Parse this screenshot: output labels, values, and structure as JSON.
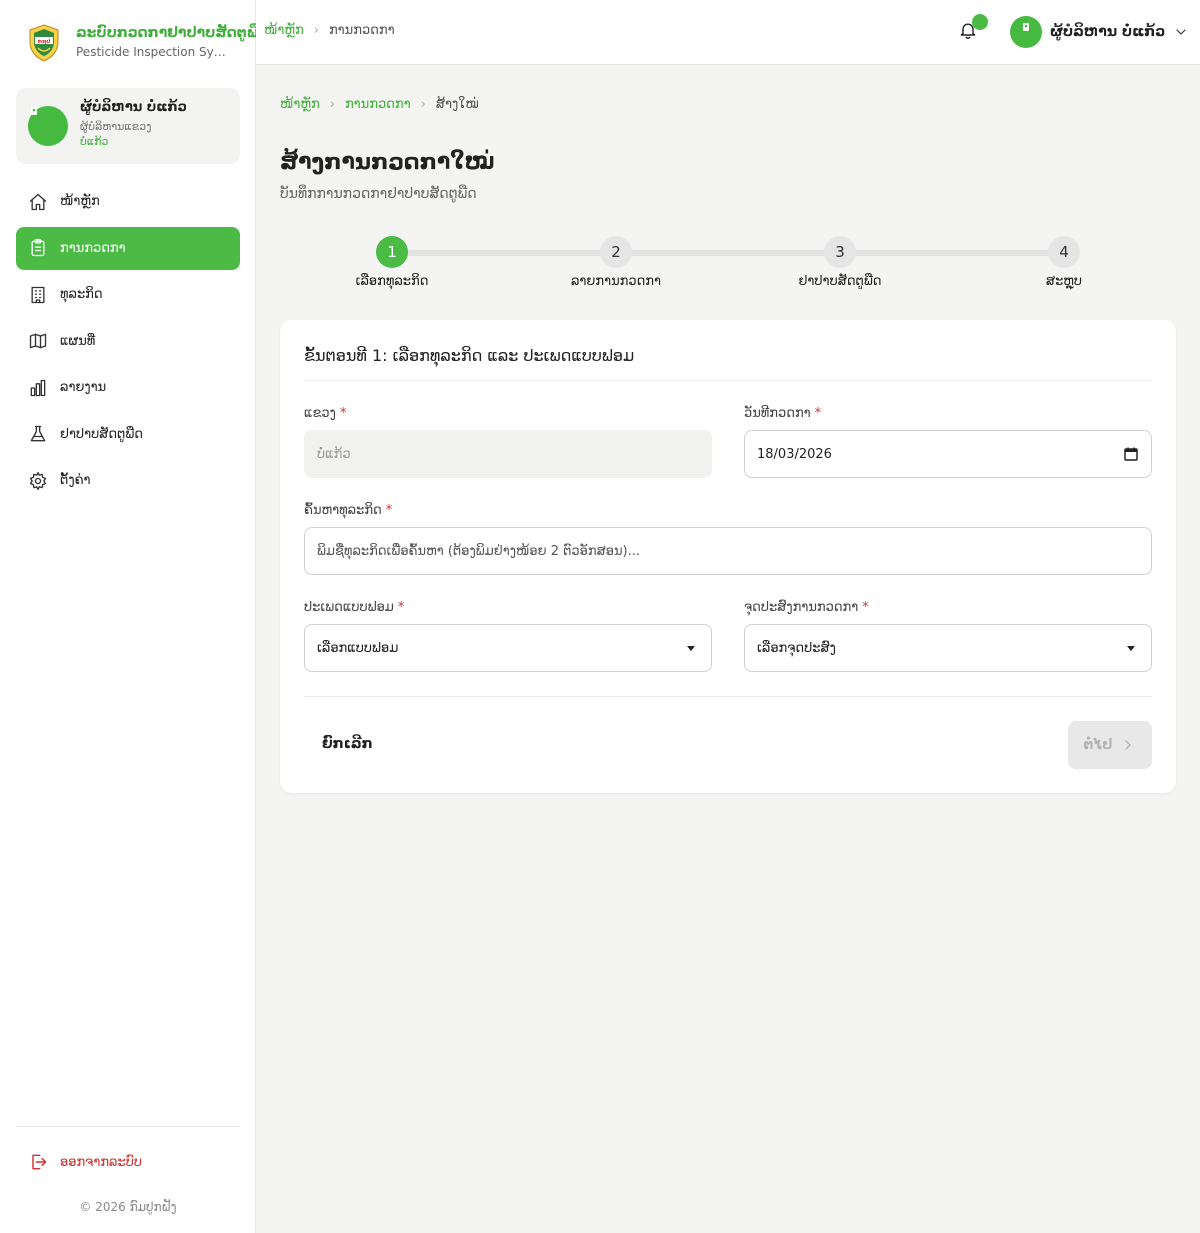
{
  "brand": {
    "title": "ລະບົບກວດກາຢາປາບສັດຕູພືດ",
    "subtitle": "Pesticide Inspection Syst...",
    "logo_text": "ກຊປ",
    "colors": {
      "accent": "#4bbb46",
      "danger": "#d0312d"
    }
  },
  "sidebar_user": {
    "name": "ຜູ້ບໍລິຫານ ບໍ່ແກ້ວ",
    "role": "ຜູ້ບໍລິຫານແຂວງ",
    "province": "ບໍ່ແກ້ວ"
  },
  "nav": {
    "items": [
      {
        "label": "ໜ້າຫຼັກ",
        "icon": "home-icon"
      },
      {
        "label": "ການກວດກາ",
        "icon": "clipboard-icon",
        "active": true
      },
      {
        "label": "ທຸລະກິດ",
        "icon": "building-icon"
      },
      {
        "label": "ແຜນທີ່",
        "icon": "map-icon"
      },
      {
        "label": "ລາຍງານ",
        "icon": "bar-chart-icon"
      },
      {
        "label": "ຢາປາບສັດຕູພືດ",
        "icon": "flask-icon"
      },
      {
        "label": "ຕັ້ງຄ່າ",
        "icon": "gear-icon"
      }
    ],
    "logout": "ອອກຈາກລະບົບ",
    "copyright": "© 2026 ກົມປູກຝັງ"
  },
  "topbar": {
    "breadcrumb_home": "ໜ້າຫຼັກ",
    "breadcrumb_current": "ການກວດກາ",
    "user_name": "ຜູ້ບໍລິຫານ ບໍ່ແກ້ວ"
  },
  "page": {
    "breadcrumb": [
      "ໜ້າຫຼັກ",
      "ການກວດກາ",
      "ສ້າງໃໝ່"
    ],
    "title": "ສ້າງການກວດກາໃໝ່",
    "subtitle": "ບັນທຶກການກວດກາຢາປາບສັດຕູພືດ"
  },
  "stepper": {
    "current": 1,
    "steps": [
      {
        "number": "1",
        "label": "ເລືອກທຸລະກິດ"
      },
      {
        "number": "2",
        "label": "ລາຍການກວດກາ"
      },
      {
        "number": "3",
        "label": "ຢາປາບສັດຕູພືດ"
      },
      {
        "number": "4",
        "label": "ສະຫຼຸບ"
      }
    ]
  },
  "form": {
    "title": "ຂັ້ນຕອນທີ 1: ເລືອກທຸລະກິດ ແລະ ປະເພດແບບຟອມ",
    "required_mark": "*",
    "province": {
      "label": "ແຂວງ",
      "value": "ບໍ່ແກ້ວ"
    },
    "date": {
      "label": "ວັນທີກວດກາ",
      "value": "18/03/2026"
    },
    "business_search": {
      "label": "ຄົ້ນຫາທຸລະກິດ",
      "placeholder": "ພິມຊື່ທຸລະກິດເພື່ອຄົ້ນຫາ (ຕ້ອງພິມຢ່າງໜ້ອຍ 2 ຕົວອັກສອນ)..."
    },
    "form_type": {
      "label": "ປະເພດແບບຟອມ",
      "selected": "ເລືອກແບບຟອມ"
    },
    "purpose": {
      "label": "ຈຸດປະສົງການກວດກາ",
      "selected": "ເລືອກຈຸດປະສົງ"
    },
    "cancel_label": "ຍົກເລີກ",
    "next_label": "ຕໍ່ໄປ"
  }
}
